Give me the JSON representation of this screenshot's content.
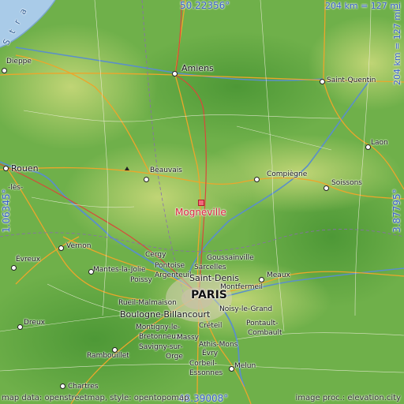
{
  "highlight": {
    "name": "Mogneville"
  },
  "coords": {
    "top": "50.22356°",
    "bottom": "48.39008°",
    "left": "1.06345°",
    "right": "3.87795°"
  },
  "scale": {
    "horizontal": "204 km = 127 mi",
    "vertical": "204 km = 127 mi"
  },
  "sea_label": "S t r a",
  "attribution": {
    "left": "map data: openstreetmap, style: opentopomap",
    "right": "image proc.: elevation.city"
  },
  "cities": {
    "amiens": "Amiens",
    "dieppe": "Dieppe",
    "saint_quentin": "Saint-Quentin",
    "laon": "Laon",
    "rouen": "Rouen",
    "beauvais": "Beauvais",
    "compiegne": "Compiègne",
    "soissons": "Soissons",
    "evreux": "Évreux",
    "vernon": "Vernon",
    "cergy": "Cergy",
    "pontoise": "Pontoise",
    "sarcelles": "Sarcelles",
    "goussainville": "Goussainville",
    "mantes": "Mantes-la-Jolie",
    "poissy": "Poissy",
    "argenteuil": "Argenteuil",
    "saint_denis": "Saint-Denis",
    "meaux": "Meaux",
    "montfermeil": "Montfermeil",
    "paris": "PARIS",
    "rueil": "Rueil-Malmaison",
    "noisy": "Noisy-le-Grand",
    "dreux": "Dreux",
    "boulogne": "Boulogne-Billancourt",
    "montigny": "Montigny-le-",
    "bretonneux": "Bretonneux",
    "creteil": "Créteil",
    "pontault": "Pontault-",
    "combault": "Combault",
    "massy": "Massy",
    "athis": "Athis-Mons",
    "savigny": "Savigny-sur-",
    "orge": "Orge",
    "evry": "Évry",
    "rambouillet": "Rambouillet",
    "corbeil": "Corbeil-",
    "essonnes": "Essonnes",
    "melun": "Melun",
    "chartres": "Chartres",
    "les": "-lès-"
  },
  "colors": {
    "highlight": "#d8213b",
    "coord_text": "#3a62c8",
    "sea": "#a9cbe8",
    "lowland": "#6fb04a",
    "upland": "#c9d97a"
  }
}
